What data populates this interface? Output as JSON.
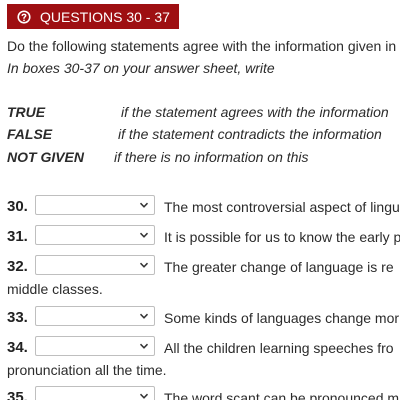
{
  "header": {
    "icon": "help-circle-icon",
    "title": "QUESTIONS 30 - 37",
    "bg_color": "#9e0f12"
  },
  "instructions": {
    "line1": "Do the following statements agree with the information given in",
    "line2": "In boxes 30-37 on your answer sheet, write"
  },
  "key": [
    {
      "term": "TRUE",
      "meaning": "if the statement agrees with the information"
    },
    {
      "term": "FALSE",
      "meaning": "if the statement contradicts the information"
    },
    {
      "term": "NOT GIVEN",
      "meaning": "if there is no information on this"
    }
  ],
  "questions": [
    {
      "number": "30.",
      "select_value": "",
      "text": "The most controversial aspect of lingu",
      "continuation": ""
    },
    {
      "number": "31.",
      "select_value": "",
      "text": "It is possible for us to know the early p",
      "continuation": ""
    },
    {
      "number": "32.",
      "select_value": "",
      "text": "The greater change of language is re",
      "continuation": "middle classes."
    },
    {
      "number": "33.",
      "select_value": "",
      "text": "Some kinds of languages change mor",
      "continuation": ""
    },
    {
      "number": "34.",
      "select_value": "",
      "text": "All the children learning speeches fro",
      "continuation": "pronunciation all the time."
    },
    {
      "number": "35.",
      "select_value": "",
      "text": "The word scant can be pronounced m",
      "continuation": ""
    }
  ]
}
